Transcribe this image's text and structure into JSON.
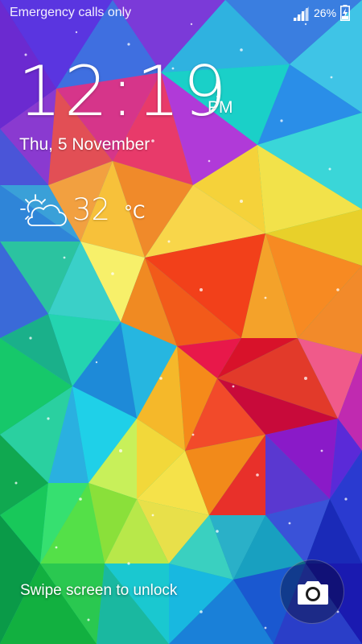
{
  "status_bar": {
    "carrier_text": "Emergency calls only",
    "battery_percent": "26%",
    "battery_level": 0.26,
    "signal_icon": "signal-bars-icon",
    "battery_icon": "battery-charging-icon"
  },
  "lockscreen": {
    "time": "12:19",
    "ampm": "PM",
    "date": "Thu, 5 November",
    "weather": {
      "icon": "partly-cloudy-icon",
      "temperature": "32",
      "unit": "°C"
    },
    "unlock_hint": "Swipe screen to unlock",
    "camera_shortcut_icon": "camera-icon"
  },
  "colors": {
    "text": "#ffffff",
    "camera_button_bg": "rgba(0,0,0,0.32)"
  }
}
